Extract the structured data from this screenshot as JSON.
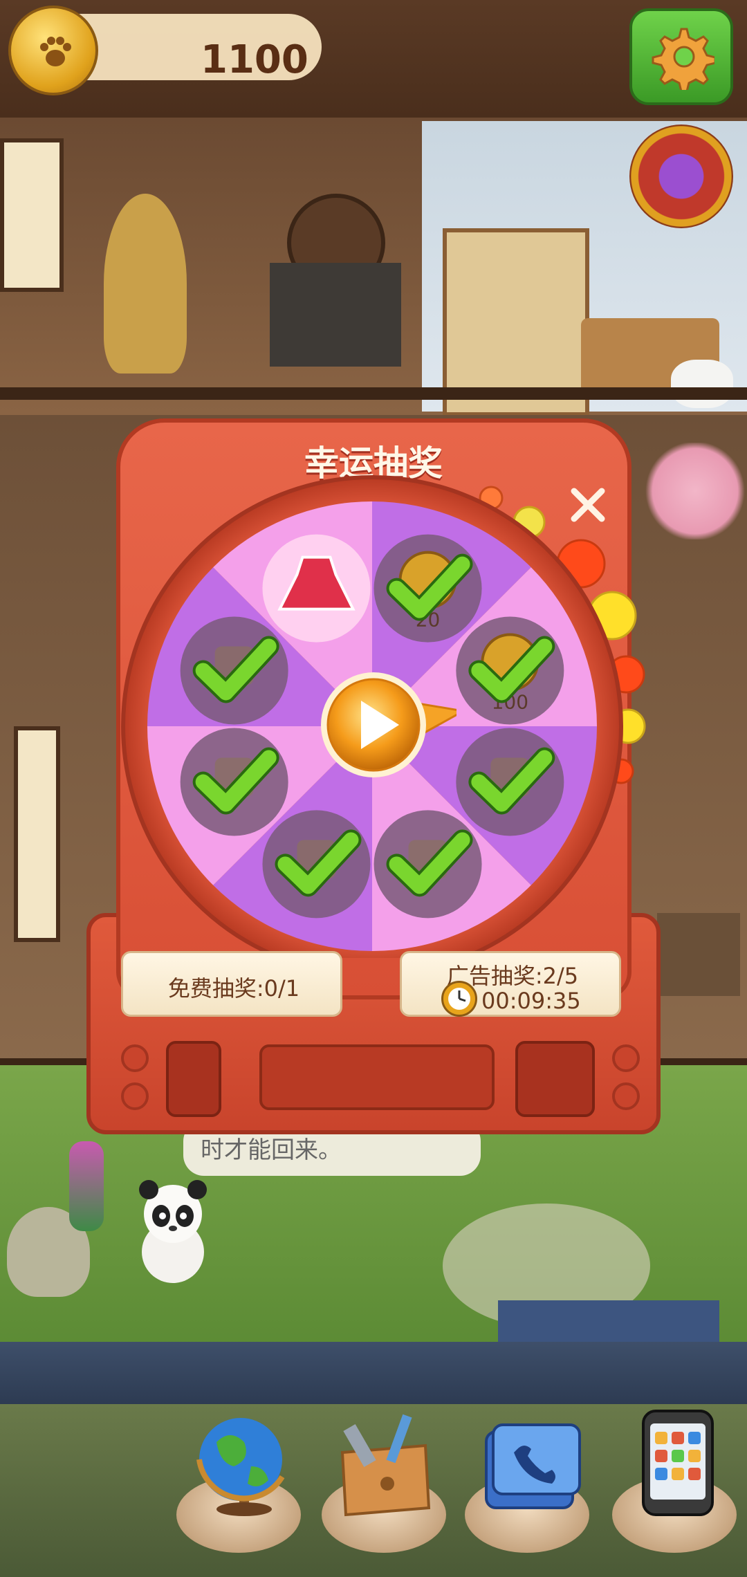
{
  "header": {
    "coins": "1100",
    "coin_icon": "paw-coin-icon",
    "settings_icon": "gear-icon",
    "lucky_wheel_icon": "lucky-wheel-icon"
  },
  "lottery": {
    "title": "幸运抽奖",
    "close_icon": "close-icon",
    "spin_icon": "play-icon",
    "prizes": [
      {
        "label": "",
        "icon": "dress-icon",
        "claimed": false
      },
      {
        "label": "20",
        "icon": "coin-icon",
        "claimed": true
      },
      {
        "label": "100",
        "icon": "coin-icon",
        "claimed": true
      },
      {
        "label": "",
        "icon": "boot-icon",
        "claimed": true
      },
      {
        "label": "",
        "icon": "furniture-icon",
        "claimed": true
      },
      {
        "label": "",
        "icon": "furniture-icon",
        "claimed": true
      },
      {
        "label": "",
        "icon": "headdress-icon",
        "claimed": true
      },
      {
        "label": "",
        "icon": "item-icon",
        "claimed": true
      }
    ],
    "free_draw": "免费抽奖:0/1",
    "ad_draw": "广告抽奖:2/5",
    "ad_timer": "00:09:35",
    "colors": {
      "panel": "#d84f35",
      "wheel_light": "#f4a0ea",
      "wheel_dark": "#c06ee6",
      "check": "#7ad62e"
    }
  },
  "scene": {
    "speech_bubble": "时才能回来。"
  },
  "nav": [
    {
      "name": "globe",
      "icon": "globe-icon"
    },
    {
      "name": "toolbox",
      "icon": "toolbox-icon"
    },
    {
      "name": "phone-book",
      "icon": "phone-book-icon"
    },
    {
      "name": "mobile-phone",
      "icon": "phone-icon"
    }
  ]
}
